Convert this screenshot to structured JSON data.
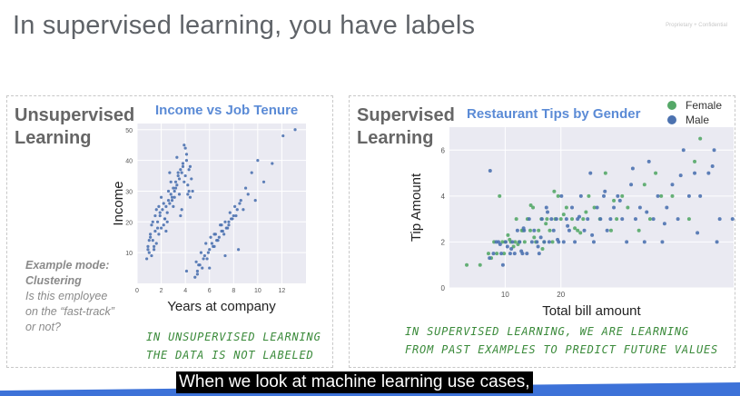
{
  "slide": {
    "title": "In supervised learning, you have labels",
    "confidential": "Proprietary + Confidential",
    "caption": "When we look at machine learning use cases,"
  },
  "left_panel": {
    "heading": "Unsupervised\nLearning",
    "example_line1": "Example mode:",
    "example_line2": "Clustering",
    "example_q1": "Is this employee",
    "example_q2": "on the “fast-track”",
    "example_q3": "or not?",
    "note_line1": "In unsupervised learning",
    "note_line2": "the data is not labeled"
  },
  "right_panel": {
    "heading": "Supervised\nLearning",
    "note_line1": "In supervised learning, we are learning",
    "note_line2": "from past examples to predict future values"
  },
  "colors": {
    "title_gray": "#5f6368",
    "chart_blue": "#4c72b0",
    "chart_green": "#55a868",
    "plot_bg": "#eaeaf2",
    "hand_green": "#3a8a3a",
    "accent_title": "#5b8bd6"
  },
  "chart_data": [
    {
      "type": "scatter",
      "title": "Income vs Job Tenure",
      "xlabel": "Years at company",
      "ylabel": "Income",
      "xlim": [
        0,
        14
      ],
      "ylim": [
        0,
        52
      ],
      "xticks": [
        0,
        2,
        4,
        6,
        8,
        10,
        12
      ],
      "yticks": [
        10,
        20,
        30,
        40,
        50
      ],
      "grid": true,
      "series": [
        {
          "x": [
            0.8,
            0.9,
            1.0,
            1.1,
            1.2,
            1.3,
            1.4,
            1.5,
            1.6,
            1.7,
            1.8,
            1.9,
            2.0,
            2.1,
            2.2,
            2.3,
            2.4,
            2.5,
            2.6,
            2.7,
            2.8,
            2.9,
            3.0,
            3.1,
            3.2,
            3.3,
            3.4,
            3.5,
            3.6,
            3.7,
            3.8,
            3.9,
            4.0,
            4.1,
            4.2,
            4.3,
            4.4,
            4.5,
            1.0,
            1.2,
            1.5,
            1.8,
            2.0,
            2.3,
            2.6,
            2.9,
            3.2,
            3.5,
            3.8,
            4.1,
            0.9,
            1.1,
            1.4,
            1.7,
            1.9,
            2.2,
            2.5,
            2.8,
            3.1,
            3.4,
            3.7,
            4.0,
            4.3,
            1.3,
            1.6,
            2.4,
            3.0,
            3.6,
            4.2,
            2.7,
            3.3,
            3.9,
            4.4,
            4.6,
            4.8,
            5.0,
            5.2,
            5.4,
            5.6,
            5.8,
            6.0,
            6.2,
            6.4,
            6.6,
            6.8,
            7.0,
            7.2,
            7.4,
            7.6,
            7.8,
            8.0,
            8.3,
            8.6,
            4.1,
            4.9,
            5.3,
            5.7,
            6.1,
            6.5,
            6.9,
            7.3,
            7.7,
            8.1,
            8.5,
            9.0,
            9.5,
            10.0,
            5.1,
            5.5,
            5.9,
            6.3,
            6.7,
            7.1,
            7.5,
            7.9,
            8.8,
            6.4,
            7.0,
            7.6,
            8.2,
            9.2,
            10.5,
            11.2,
            12.1,
            13.1,
            5.0,
            6.0,
            7.3,
            8.4,
            9.8
          ],
          "y": [
            8,
            12,
            10,
            15,
            9,
            14,
            11,
            17,
            13,
            20,
            16,
            22,
            18,
            24,
            19,
            21,
            25,
            23,
            27,
            26,
            29,
            28,
            31,
            30,
            33,
            32,
            35,
            34,
            37,
            36,
            38,
            33,
            35,
            40,
            32,
            30,
            38,
            34,
            14,
            19,
            22,
            25,
            28,
            21,
            30,
            27,
            31,
            29,
            39,
            42,
            11,
            16,
            12,
            18,
            23,
            26,
            20,
            33,
            28,
            36,
            24,
            44,
            37,
            20,
            24,
            17,
            25,
            22,
            29,
            36,
            41,
            45,
            28,
            30,
            2,
            4,
            6,
            5,
            9,
            8,
            11,
            13,
            12,
            14,
            15,
            17,
            16,
            18,
            19,
            21,
            22,
            24,
            27,
            4,
            7,
            10,
            13,
            15,
            16,
            19,
            20,
            23,
            25,
            26,
            31,
            36,
            40,
            6,
            8,
            10,
            12,
            14,
            17,
            18,
            21,
            24,
            16,
            19,
            20,
            22,
            29,
            33,
            39,
            48,
            50,
            3,
            5,
            9,
            11,
            27
          ]
        }
      ]
    },
    {
      "type": "scatter",
      "title": "Restaurant Tips by Gender",
      "xlabel": "Total bill amount",
      "ylabel": "Tip Amount",
      "xlim": [
        0,
        51
      ],
      "ylim": [
        0,
        7
      ],
      "xticks": [
        10,
        20
      ],
      "yticks": [
        0,
        2,
        4,
        6
      ],
      "grid": true,
      "legend": "top-right",
      "series": [
        {
          "name": "Female",
          "x": [
            3.1,
            5.5,
            7.0,
            7.5,
            8.0,
            8.5,
            9.0,
            9.5,
            10.0,
            10.5,
            11.0,
            11.5,
            12.0,
            12.5,
            13.0,
            13.5,
            14.0,
            14.5,
            15.0,
            15.5,
            16.0,
            16.5,
            17.0,
            17.5,
            18.0,
            18.5,
            19.0,
            19.5,
            20.0,
            21.0,
            22.0,
            23.0,
            24.0,
            25.0,
            26.0,
            27.0,
            28.0,
            29.0,
            30.0,
            31.0,
            32.0,
            34.0,
            35.0,
            36.0,
            37.0,
            38.0,
            40.0,
            43.0,
            44.0,
            45.0,
            9.8,
            11.8,
            13.2,
            15.2,
            17.3,
            18.8,
            20.5,
            22.5,
            24.5,
            29.5,
            10.8,
            12.3,
            14.6,
            16.7,
            23.5
          ],
          "y": [
            1.0,
            1.0,
            1.5,
            1.3,
            2.0,
            1.5,
            4.0,
            2.0,
            2.0,
            2.3,
            2.0,
            1.8,
            3.0,
            2.0,
            2.5,
            2.0,
            3.0,
            2.5,
            3.5,
            2.0,
            2.5,
            3.0,
            2.0,
            3.0,
            2.5,
            2.0,
            3.0,
            4.0,
            3.0,
            3.5,
            3.0,
            2.5,
            3.0,
            4.0,
            3.5,
            3.0,
            5.0,
            2.5,
            3.0,
            4.0,
            3.5,
            2.5,
            4.5,
            3.0,
            5.0,
            4.0,
            4.0,
            3.0,
            5.5,
            6.5,
            1.5,
            2.0,
            2.5,
            2.2,
            2.8,
            4.2,
            3.2,
            2.6,
            3.3,
            3.8,
            2.1,
            1.9,
            3.6,
            1.7,
            2.4
          ]
        },
        {
          "name": "Male",
          "x": [
            7.3,
            7.9,
            8.4,
            8.8,
            9.3,
            9.6,
            10.1,
            10.4,
            10.9,
            11.3,
            11.7,
            12.2,
            12.6,
            13.1,
            13.4,
            13.9,
            14.3,
            14.8,
            15.2,
            15.7,
            16.1,
            16.6,
            17.0,
            17.4,
            17.9,
            18.3,
            18.7,
            19.2,
            19.6,
            20.1,
            20.5,
            21.0,
            21.5,
            22.0,
            22.5,
            23.0,
            23.6,
            24.2,
            24.8,
            25.3,
            25.9,
            26.5,
            27.1,
            27.7,
            28.3,
            28.9,
            29.5,
            30.2,
            31.0,
            31.8,
            32.6,
            33.4,
            34.2,
            35.0,
            35.8,
            36.6,
            37.4,
            38.2,
            39.0,
            40.0,
            41.0,
            42.0,
            43.0,
            44.0,
            45.0,
            46.5,
            47.5,
            48.5,
            48.0,
            50.8,
            7.2,
            9.1,
            11.1,
            13.3,
            15.9,
            17.6,
            19.4,
            21.2,
            23.3,
            25.6,
            27.9,
            30.6,
            32.9,
            35.4,
            38.6,
            41.5,
            44.5,
            47.2,
            12.9,
            16.4
          ],
          "y": [
            5.1,
            1.5,
            2.0,
            2.0,
            1.5,
            1.0,
            2.0,
            1.8,
            1.5,
            2.0,
            1.5,
            2.5,
            2.0,
            1.5,
            2.5,
            1.5,
            3.0,
            2.0,
            2.5,
            2.0,
            1.5,
            3.0,
            2.0,
            3.5,
            2.0,
            3.0,
            2.5,
            3.0,
            2.0,
            4.0,
            2.0,
            3.0,
            2.5,
            3.5,
            2.0,
            3.0,
            4.0,
            2.5,
            3.0,
            5.0,
            2.0,
            3.5,
            3.0,
            4.0,
            2.5,
            3.0,
            3.5,
            4.0,
            3.0,
            2.0,
            4.5,
            3.0,
            3.5,
            2.0,
            5.5,
            3.0,
            4.0,
            2.0,
            3.5,
            4.5,
            3.0,
            6.0,
            4.0,
            5.0,
            4.0,
            5.0,
            6.0,
            3.0,
            2.0,
            3.0,
            1.3,
            1.9,
            1.7,
            2.6,
            1.8,
            3.3,
            2.1,
            2.7,
            3.1,
            2.3,
            4.2,
            3.8,
            5.2,
            3.3,
            2.8,
            4.9,
            2.4,
            5.3,
            1.6,
            2.2
          ]
        }
      ]
    }
  ]
}
